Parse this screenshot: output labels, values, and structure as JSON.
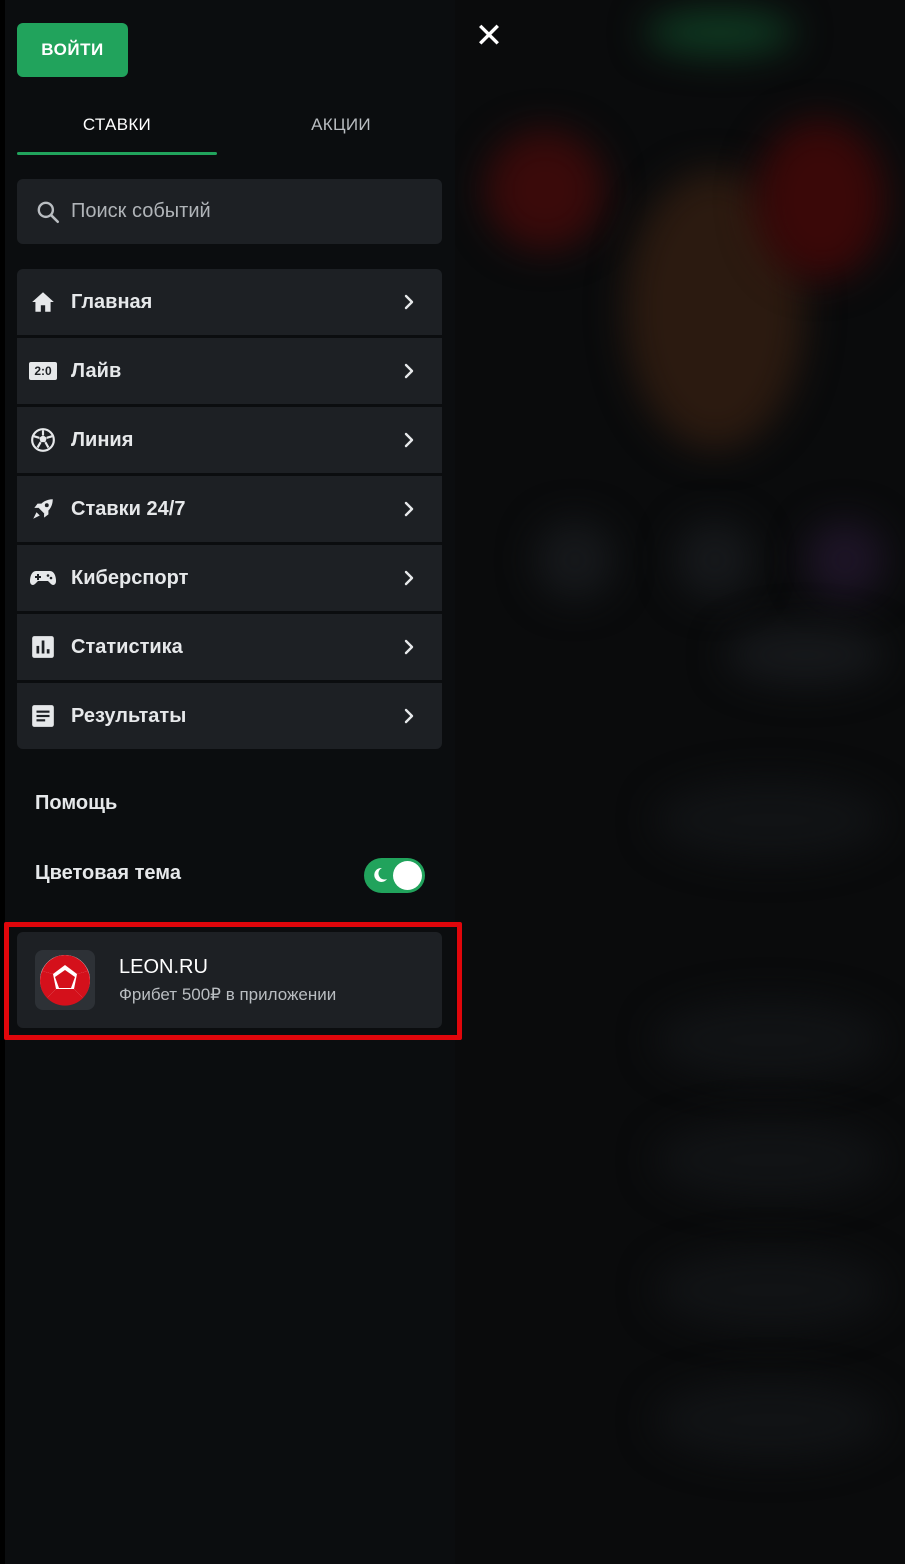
{
  "header": {
    "login_label": "ВОЙТИ",
    "close_icon": "close-icon"
  },
  "tabs": [
    {
      "label": "СТАВКИ",
      "active": true
    },
    {
      "label": "АКЦИИ",
      "active": false
    }
  ],
  "search": {
    "placeholder": "Поиск событий",
    "value": ""
  },
  "menu": {
    "items": [
      {
        "label": "Главная",
        "icon": "home-icon"
      },
      {
        "label": "Лайв",
        "icon": "live-score-icon",
        "icon_text": "2:0"
      },
      {
        "label": "Линия",
        "icon": "soccer-ball-icon"
      },
      {
        "label": "Ставки 24/7",
        "icon": "rocket-icon"
      },
      {
        "label": "Киберспорт",
        "icon": "gamepad-icon"
      },
      {
        "label": "Статистика",
        "icon": "statistics-icon"
      },
      {
        "label": "Результаты",
        "icon": "results-icon"
      }
    ]
  },
  "help": {
    "label": "Помощь"
  },
  "theme": {
    "label": "Цветовая тема",
    "toggle_on": true
  },
  "app_banner": {
    "title": "LEON.RU",
    "subtitle": "Фрибет 500₽ в приложении"
  },
  "colors": {
    "accent": "#21a35c",
    "highlight": "#e0060b",
    "panel": "#1d2024",
    "background": "#0b0d0f"
  }
}
